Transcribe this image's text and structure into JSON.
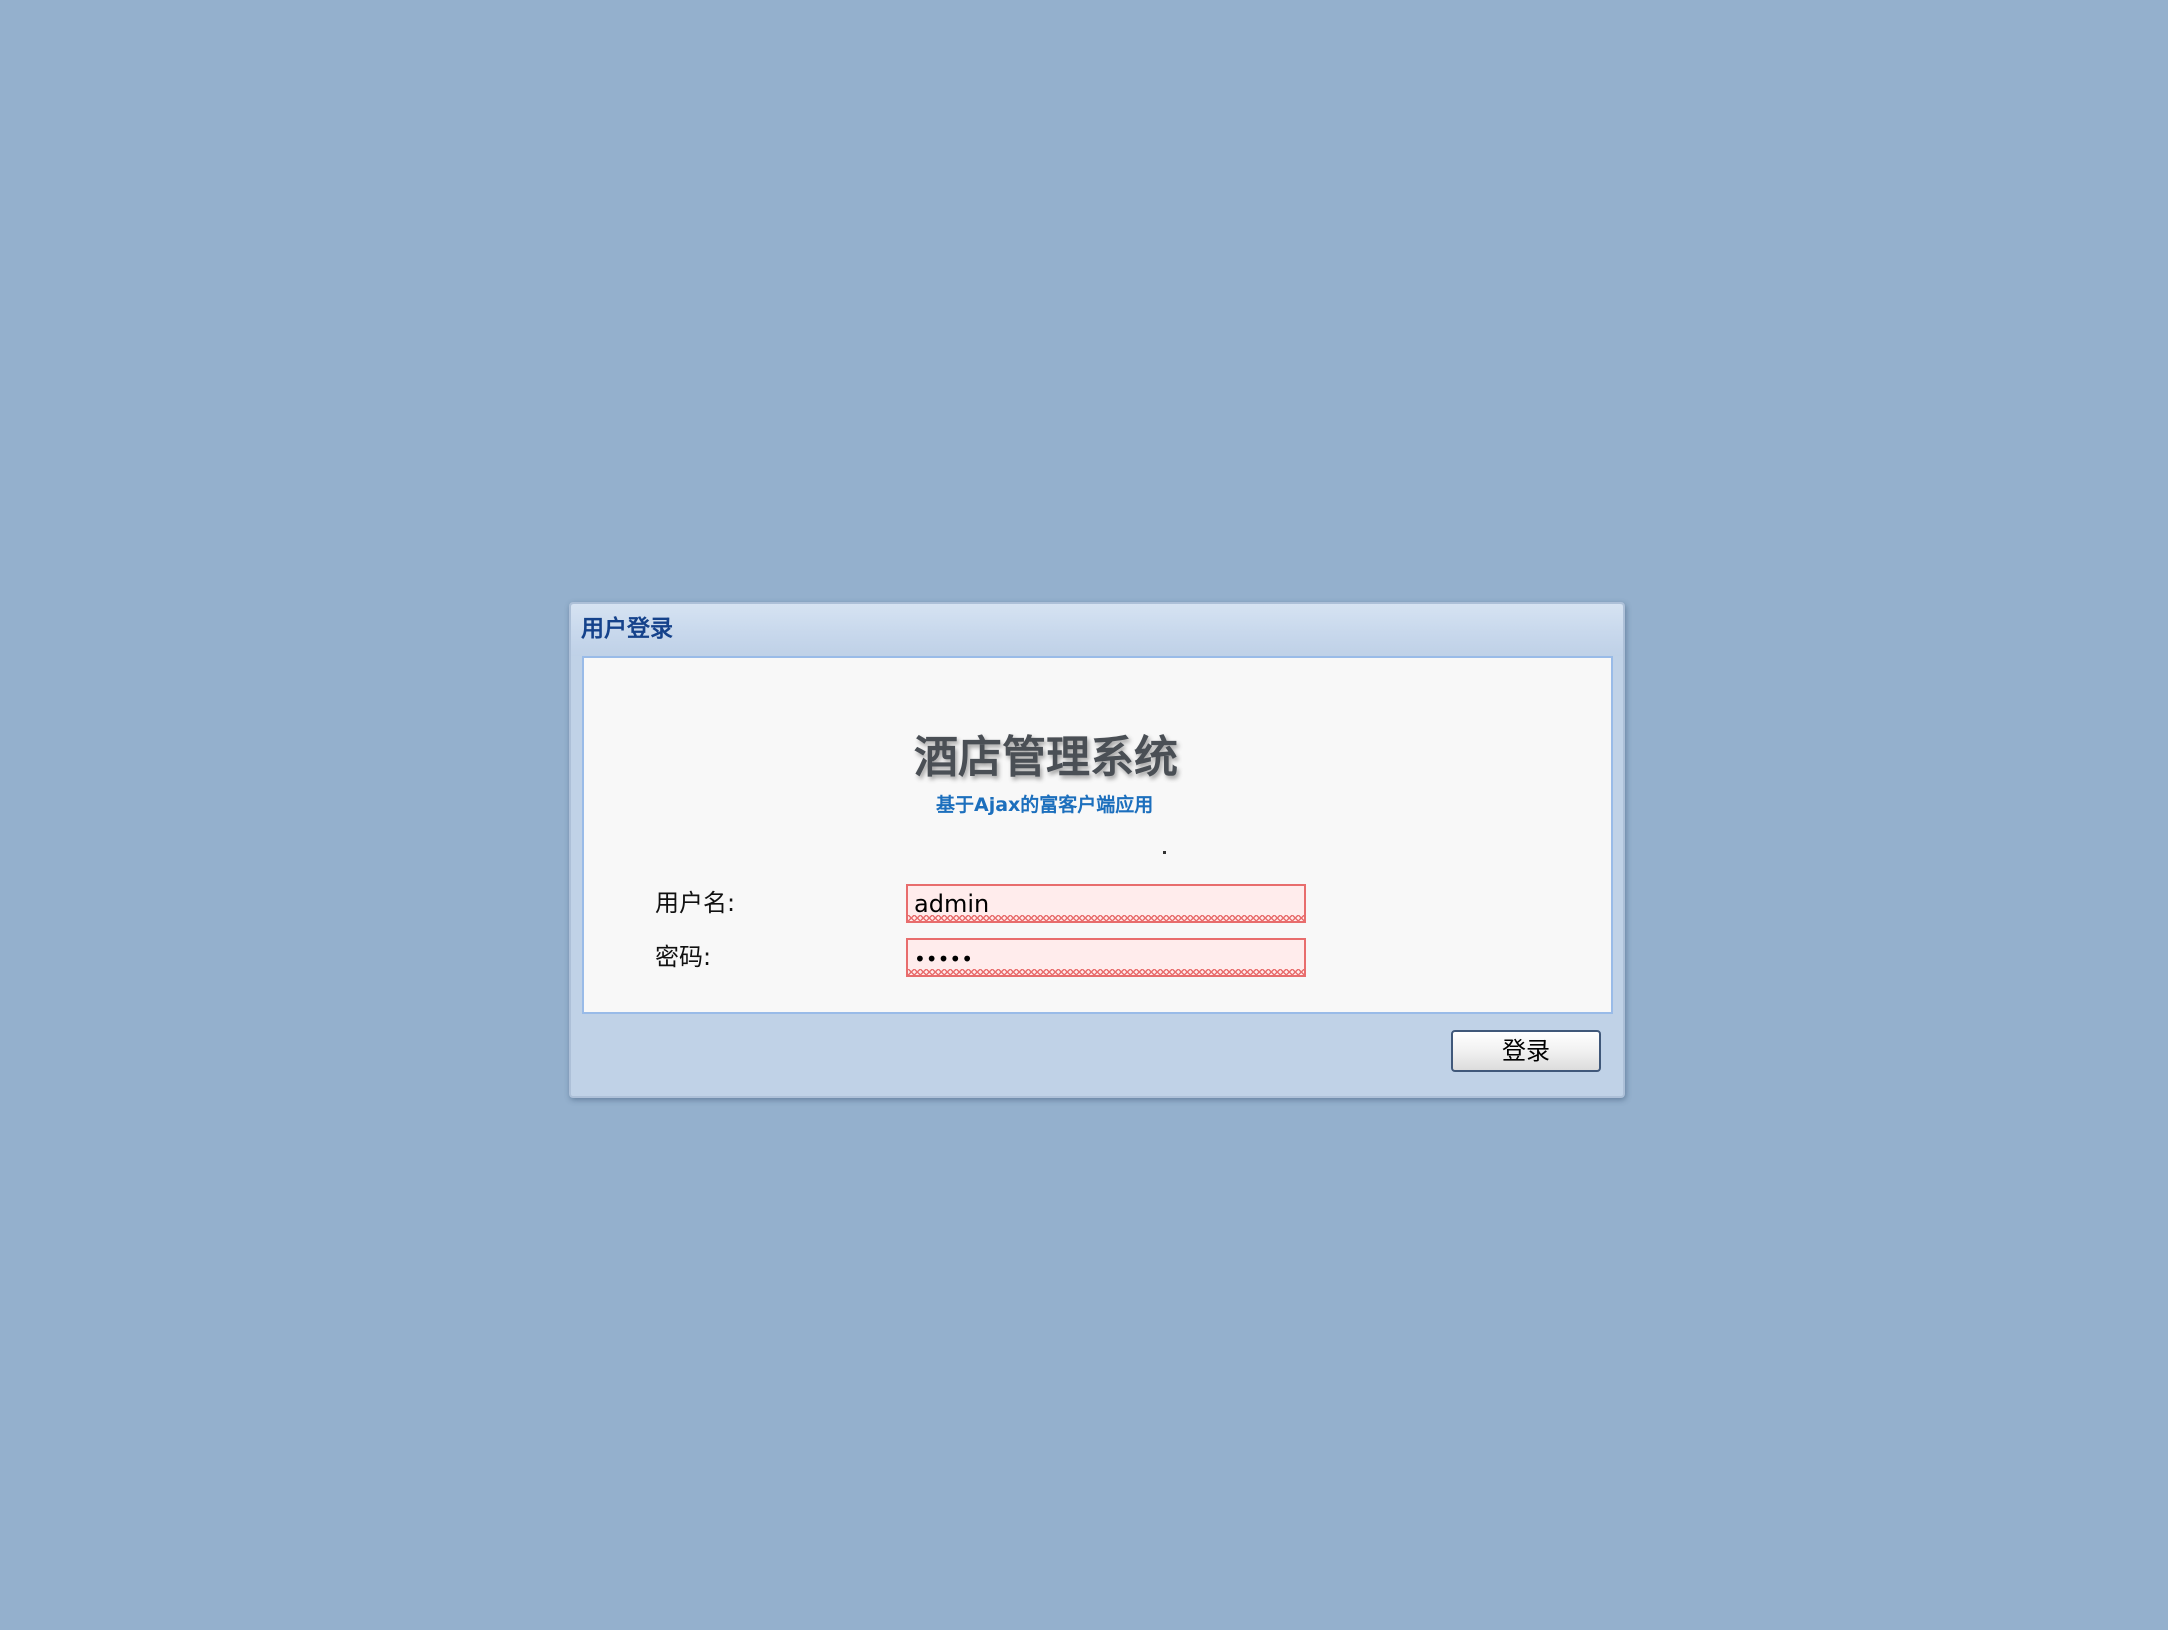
{
  "window": {
    "title": "用户登录"
  },
  "banner": {
    "title": "酒店管理系统",
    "subtitle": "基于Ajax的富客户端应用"
  },
  "form": {
    "username_label": "用户名:",
    "username_value": "admin",
    "password_label": "密码:",
    "password_value": "•••••",
    "fields_invalid": true
  },
  "actions": {
    "login_label": "登录"
  },
  "colors": {
    "page_background": "#94b0cd",
    "title_text": "#15428b",
    "subtitle_text": "#1c6fbd",
    "invalid_border": "#e86d6d",
    "invalid_fill": "#ffecec"
  }
}
